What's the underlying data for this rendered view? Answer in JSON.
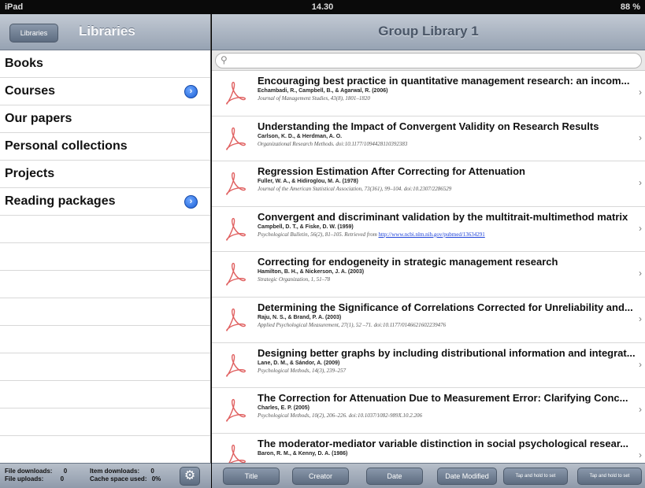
{
  "status_bar": {
    "device": "iPad",
    "time": "14.30",
    "battery": "88 %"
  },
  "sidebar": {
    "back_label": "Libraries",
    "title": "Libraries",
    "items": [
      {
        "label": "Books",
        "disclosure": false
      },
      {
        "label": "Courses",
        "disclosure": true
      },
      {
        "label": "Our papers",
        "disclosure": false
      },
      {
        "label": "Personal collections",
        "disclosure": false
      },
      {
        "label": "Projects",
        "disclosure": false
      },
      {
        "label": "Reading packages",
        "disclosure": true
      }
    ],
    "footer": {
      "file_downloads_label": "File downloads:",
      "file_downloads": "0",
      "file_uploads_label": "File uploads:",
      "file_uploads": "0",
      "item_downloads_label": "Item downloads:",
      "item_downloads": "0",
      "cache_label": "Cache space used:",
      "cache": "0%"
    }
  },
  "main": {
    "title": "Group Library 1",
    "search": {
      "placeholder": ""
    },
    "papers": [
      {
        "title": "Encouraging best practice in quantitative management research: an incom...",
        "authors": "Echambadi, R., Campbell, B., & Agarwal, R. (2006)",
        "ref": "Journal of Management Studies, 43(8), 1801–1820",
        "link": ""
      },
      {
        "title": "Understanding the Impact of Convergent Validity on Research Results",
        "authors": "Carlson, K. D., & Herdman, A. O.",
        "ref": "Organizational Research Methods. doi:10.1177/1094428110392383",
        "link": ""
      },
      {
        "title": "Regression Estimation After Correcting for Attenuation",
        "authors": "Fuller, W. A., & Hidiroglou, M. A. (1978)",
        "ref": "Journal of the American Statistical Association, 73(361), 99–104. doi:10.2307/2286529",
        "link": ""
      },
      {
        "title": "Convergent and discriminant validation by the multitrait-multimethod matrix",
        "authors": "Campbell, D. T., & Fiske, D. W. (1959)",
        "ref": "Psychological Bulletin, 56(2), 81–105. Retrieved from ",
        "link": "http://www.ncbi.nlm.nih.gov/pubmed/13634291"
      },
      {
        "title": "Correcting for endogeneity in strategic management research",
        "authors": "Hamilton, B. H., & Nickerson, J. A. (2003)",
        "ref": "Strategic Organization, 1, 51–78",
        "link": ""
      },
      {
        "title": "Determining the Significance of Correlations Corrected for Unreliability and...",
        "authors": "Raju, N. S., & Brand, P. A. (2003)",
        "ref": "Applied Psychological Measurement, 27(1), 52 –71. doi:10.1177/0146621602239476",
        "link": ""
      },
      {
        "title": "Designing better graphs by including distributional information and integrat...",
        "authors": "Lane, D. M., & Sándor, A. (2009)",
        "ref": "Psychological Methods, 14(3), 239–257",
        "link": ""
      },
      {
        "title": "The Correction for Attenuation Due to Measurement Error: Clarifying Conc...",
        "authors": "Charles, E. P. (2005)",
        "ref": "Psychological Methods, 10(2), 206–226. doi:10.1037/1082-989X.10.2.206",
        "link": ""
      },
      {
        "title": "The moderator-mediator variable distinction in social psychological resear...",
        "authors": "Baron, R. M., & Kenny, D. A. (1986)",
        "ref": "",
        "link": ""
      }
    ],
    "toolbar": {
      "title": "Title",
      "creator": "Creator",
      "date": "Date",
      "date_modified": "Date Modified",
      "tap_hold_1": "Tap and hold to set",
      "tap_hold_2": "Tap and hold to set"
    }
  }
}
